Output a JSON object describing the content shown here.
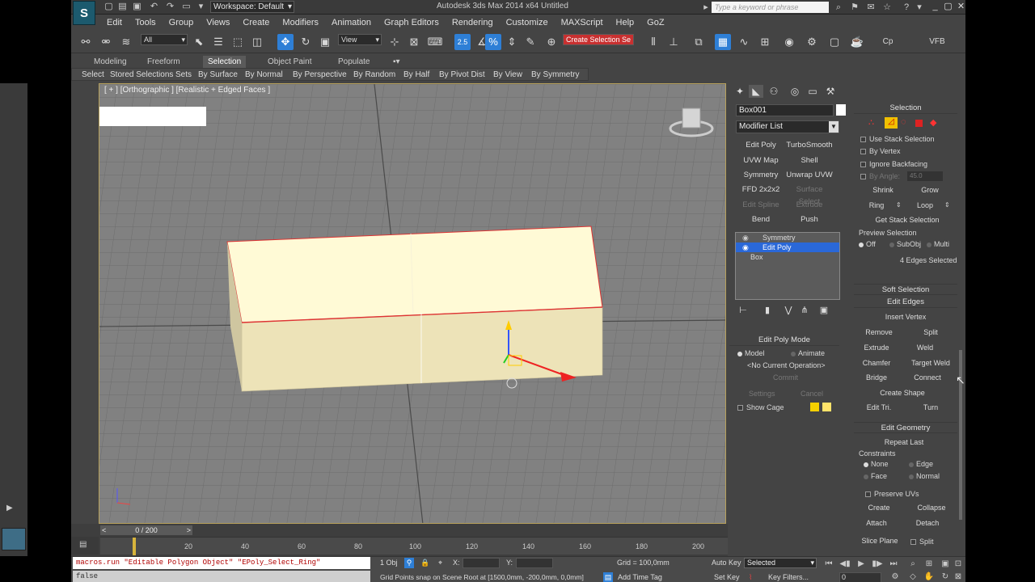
{
  "titlebar": {
    "workspace": "Workspace: Default",
    "title": "Autodesk 3ds Max  2014 x64      Untitled",
    "search_placeholder": "Type a keyword or phrase"
  },
  "menu": [
    "Edit",
    "Tools",
    "Group",
    "Views",
    "Create",
    "Modifiers",
    "Animation",
    "Graph Editors",
    "Rendering",
    "Customize",
    "MAXScript",
    "Help",
    "GoZ"
  ],
  "toolbar": {
    "filter_value": "All",
    "refcoord_value": "View",
    "create_selection_set": "Create Selection Se",
    "snap_label": "2.5",
    "extra_labels": [
      "Cp",
      "VFB"
    ]
  },
  "ribbon_tabs": [
    {
      "label": "Modeling",
      "active": false
    },
    {
      "label": "Freeform",
      "active": false
    },
    {
      "label": "Selection",
      "active": true
    },
    {
      "label": "Object Paint",
      "active": false
    },
    {
      "label": "Populate",
      "active": false
    }
  ],
  "ribbon_items": [
    "Select",
    "Stored Selections",
    "Sets",
    "By Surface",
    "By Normal",
    "By Perspective",
    "By Random",
    "By Half",
    "By Pivot Dist",
    "By View",
    "By Symmetry"
  ],
  "viewport": {
    "label": "[ + ] [Orthographic ] [Realistic + Edged Faces ]"
  },
  "command_panel": {
    "object_name": "Box001",
    "modifier_list": "Modifier List",
    "modifier_buttons": [
      {
        "label": "Edit Poly",
        "dim": false
      },
      {
        "label": "TurboSmooth",
        "dim": false
      },
      {
        "label": "UVW Map",
        "dim": false
      },
      {
        "label": "Shell",
        "dim": false
      },
      {
        "label": "Symmetry",
        "dim": false
      },
      {
        "label": "Unwrap UVW",
        "dim": false
      },
      {
        "label": "FFD 2x2x2",
        "dim": false
      },
      {
        "label": "Surface Select",
        "dim": true
      },
      {
        "label": "Edit Spline",
        "dim": true
      },
      {
        "label": "Extrude",
        "dim": true
      },
      {
        "label": "Bend",
        "dim": false
      },
      {
        "label": "Push",
        "dim": false
      }
    ],
    "stack": [
      {
        "label": "Symmetry",
        "selected": false
      },
      {
        "label": "Edit Poly",
        "selected": true
      },
      {
        "label": "Box",
        "selected": false
      }
    ],
    "edit_poly_mode": {
      "title": "Edit Poly Mode",
      "model": "Model",
      "animate": "Animate",
      "operation": "<No Current Operation>",
      "commit": "Commit",
      "settings": "Settings",
      "cancel": "Cancel",
      "show_cage": "Show Cage"
    },
    "selection": {
      "title": "Selection",
      "use_stack": "Use Stack Selection",
      "by_vertex": "By Vertex",
      "ignore_backfacing": "Ignore Backfacing",
      "by_angle": "By Angle:",
      "by_angle_value": "45.0",
      "shrink": "Shrink",
      "grow": "Grow",
      "ring": "Ring",
      "loop": "Loop",
      "get_stack": "Get Stack Selection",
      "preview": "Preview Selection",
      "off": "Off",
      "subobj": "SubObj",
      "multi": "Multi",
      "status": "4 Edges Selected"
    },
    "soft_selection": "Soft Selection",
    "edit_edges": {
      "title": "Edit Edges",
      "insert_vertex": "Insert Vertex",
      "remove": "Remove",
      "split": "Split",
      "extrude": "Extrude",
      "weld": "Weld",
      "chamfer": "Chamfer",
      "target_weld": "Target Weld",
      "bridge": "Bridge",
      "connect": "Connect",
      "create_shape": "Create Shape",
      "edit_tri": "Edit Tri.",
      "turn": "Turn"
    },
    "edit_geometry": {
      "title": "Edit Geometry",
      "repeat_last": "Repeat Last",
      "constraints": "Constraints",
      "none": "None",
      "edge": "Edge",
      "face": "Face",
      "normal": "Normal",
      "preserve_uvs": "Preserve UVs",
      "create": "Create",
      "collapse": "Collapse",
      "attach": "Attach",
      "detach": "Detach",
      "slice_plane": "Slice Plane",
      "split": "Split"
    }
  },
  "timeline": {
    "frame": "0 / 200",
    "ticks": [
      "20",
      "40",
      "60",
      "80",
      "100",
      "120",
      "140",
      "160",
      "180",
      "200"
    ]
  },
  "status": {
    "maxscript_line1": "macros.run \"Editable Polygon Object\" \"EPoly_Select_Ring\"",
    "maxscript_line2": "false",
    "objects": "1 Obj",
    "x_label": "X:",
    "y_label": "Y:",
    "grid": "Grid = 100,0mm",
    "prompt": "Grid Points snap on Scene Root at [1500,0mm, -200,0mm, 0,0mm]",
    "add_time_tag": "Add Time Tag",
    "auto_key": "Auto Key",
    "set_key": "Set Key",
    "selected": "Selected",
    "key_filters": "Key Filters...",
    "frame_field": "0"
  }
}
